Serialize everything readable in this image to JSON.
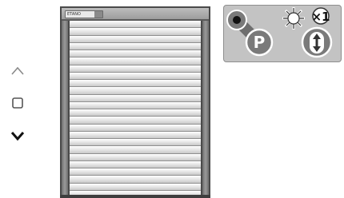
{
  "remote": {
    "up_icon": "chevron-up-icon",
    "stop_icon": "square-stop-icon",
    "down_icon": "chevron-down-icon"
  },
  "shutter": {
    "brand_label": "ETANO",
    "slat_count": 24,
    "open_fraction": 1.0
  },
  "status_panel": {
    "position_icon": "position-p-icon",
    "sun_icon": "sun-icon",
    "sun_count": "×1",
    "updown_icon": "up-down-arrow-icon"
  },
  "colors": {
    "frame": "#4a4a4a",
    "panel_bg": "#c3c3c3",
    "badge_fill": "#777777"
  }
}
